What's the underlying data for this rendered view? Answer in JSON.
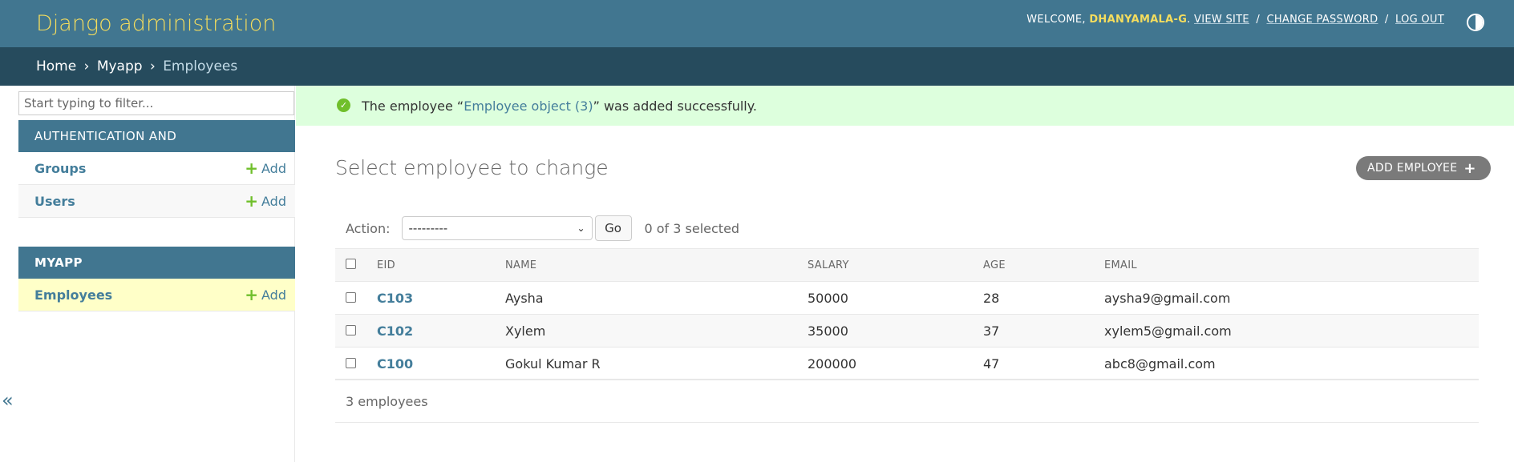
{
  "header": {
    "brand": "Django administration",
    "welcome": "WELCOME,",
    "username": "DHANYAMALA-G",
    "view_site": "VIEW SITE",
    "change_password": "CHANGE PASSWORD",
    "log_out": "LOG OUT",
    "separator": "/",
    "theme_icon": "theme-toggle-icon"
  },
  "breadcrumbs": {
    "items": [
      "Home",
      "Myapp",
      "Employees"
    ],
    "separator": "›"
  },
  "sidebar": {
    "filter_placeholder": "Start typing to filter...",
    "apps": [
      {
        "caption": "AUTHENTICATION AND AUTHORIZATION",
        "models": [
          {
            "name": "Groups",
            "add": "Add"
          },
          {
            "name": "Users",
            "add": "Add"
          }
        ]
      },
      {
        "caption": "MYAPP",
        "models": [
          {
            "name": "Employees",
            "add": "Add"
          }
        ]
      }
    ],
    "collapse_icon": "«"
  },
  "messages": {
    "success": {
      "prefix": "The employee “",
      "link": "Employee object (3)",
      "suffix": "” was added successfully."
    }
  },
  "main": {
    "title": "Select employee to change",
    "add_button": "ADD EMPLOYEE",
    "action_label": "Action:",
    "action_selected": "---------",
    "go_button": "Go",
    "action_counter": "0 of 3 selected",
    "columns": [
      "EID",
      "NAME",
      "SALARY",
      "AGE",
      "EMAIL"
    ],
    "rows": [
      {
        "eid": "C103",
        "name": "Aysha",
        "salary": "50000",
        "age": "28",
        "email": "aysha9@gmail.com"
      },
      {
        "eid": "C102",
        "name": "Xylem",
        "salary": "35000",
        "age": "37",
        "email": "xylem5@gmail.com"
      },
      {
        "eid": "C100",
        "name": "Gokul Kumar R",
        "salary": "200000",
        "age": "47",
        "email": "abc8@gmail.com"
      }
    ],
    "paginator": "3 employees"
  },
  "colors": {
    "header": "#417690",
    "breadcrumbs": "#264b5d",
    "brand": "#f5dd5d",
    "link": "#447e9b",
    "success_bg": "#dfd",
    "add_green": "#70bf2b"
  }
}
